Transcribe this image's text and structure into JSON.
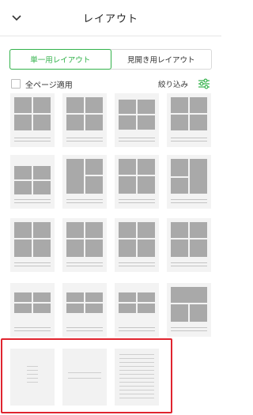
{
  "header": {
    "title": "レイアウト",
    "back_icon": "chevron-down-icon"
  },
  "tabs": [
    {
      "label": "単一用レイアウト",
      "active": true
    },
    {
      "label": "見開き用レイアウト",
      "active": false
    }
  ],
  "options": {
    "apply_all_label": "全ページ適用",
    "apply_all_checked": false,
    "filter_label": "絞り込み",
    "filter_icon": "filter-sliders-icon"
  },
  "colors": {
    "accent": "#32b24a",
    "highlight": "#e0242f",
    "photo_block": "#a9a9a9"
  }
}
